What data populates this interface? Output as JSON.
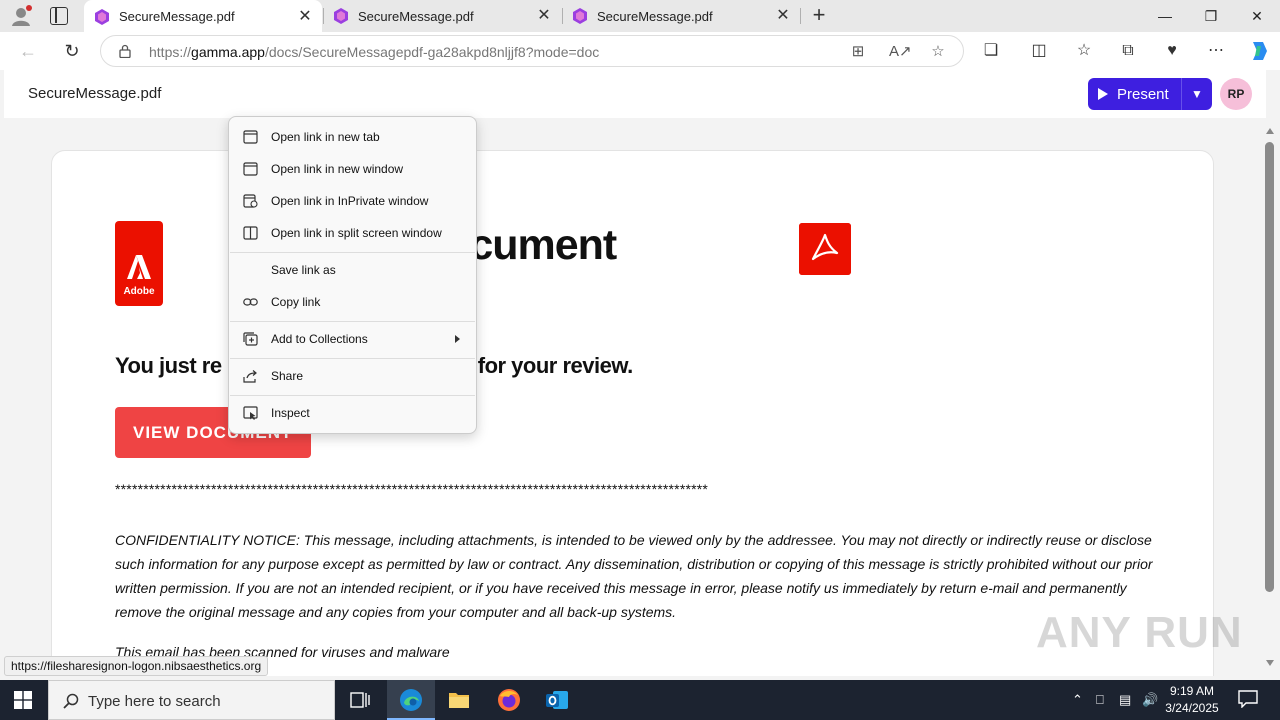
{
  "tabs": [
    {
      "label": "SecureMessage.pdf",
      "active": true
    },
    {
      "label": "SecureMessage.pdf",
      "active": false
    },
    {
      "label": "SecureMessage.pdf",
      "active": false
    }
  ],
  "address": {
    "prefix": "https://",
    "host": "gamma.app",
    "path": "/docs/SecureMessagepdf-ga28akpd8nljjf8?mode=doc"
  },
  "header": {
    "doc_title": "SecureMessage.pdf",
    "present_label": "Present",
    "avatar_initials": "RP"
  },
  "document": {
    "headline": "DF Document",
    "adobe_word": "Adobe",
    "subhead_left": "You just re",
    "subhead_right": "ment for your review.",
    "view_button": "VIEW DOCUMENT",
    "stars": "*********************************************************************************************************",
    "notice": "CONFIDENTIALITY NOTICE: This message, including attachments, is intended to be viewed only by the addressee.  You may not directly or indirectly reuse or disclose such information for any purpose except as permitted by law or contract. Any dissemination, distribution or copying of this message is strictly prohibited without our prior written permission. If you are not an intended recipient, or if you have received this message in error, please notify us immediately by return e-mail and permanently remove the original message and any copies from your computer and all back-up systems.",
    "scanned": "This email has been scanned for viruses and malware"
  },
  "context_menu": {
    "items": [
      {
        "label": "Open link in new tab",
        "icon": "new-tab-icon"
      },
      {
        "label": "Open link in new window",
        "icon": "new-window-icon"
      },
      {
        "label": "Open link in InPrivate window",
        "icon": "inprivate-icon"
      },
      {
        "label": "Open link in split screen window",
        "icon": "split-screen-icon"
      },
      {
        "label": "Save link as",
        "icon": ""
      },
      {
        "label": "Copy link",
        "icon": "link-icon"
      },
      {
        "label": "Add to Collections",
        "icon": "collections-icon",
        "submenu": true
      },
      {
        "label": "Share",
        "icon": "share-icon"
      },
      {
        "label": "Inspect",
        "icon": "inspect-icon"
      }
    ]
  },
  "status_url": "https://filesharesignon-logon.nibsaesthetics.org",
  "watermark": "ANY RUN",
  "taskbar": {
    "search_placeholder": "Type here to search",
    "time": "9:19 AM",
    "date": "3/24/2025"
  },
  "colors": {
    "accent": "#3e1fe0",
    "adobe_red": "#eb1000",
    "view_button": "#ef4444",
    "avatar_bg": "#f6bfd9"
  }
}
